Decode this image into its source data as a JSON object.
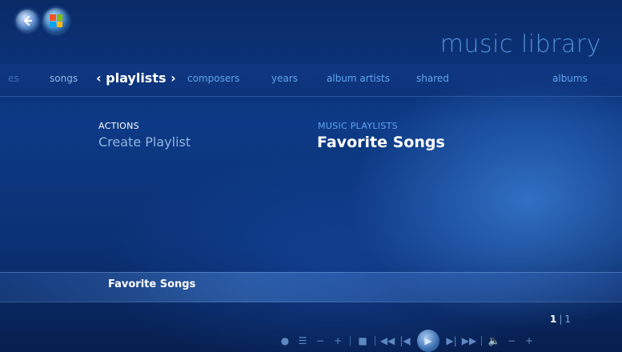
{
  "app": {
    "title": "music library",
    "icons": {
      "back": "back-arrow-icon",
      "start": "windows-start-icon"
    }
  },
  "pivot": {
    "items": [
      {
        "label": "es"
      },
      {
        "label": "songs"
      },
      {
        "label": "‹ playlists ›",
        "selected": true
      },
      {
        "label": "composers"
      },
      {
        "label": "years"
      },
      {
        "label": "album artists"
      },
      {
        "label": "shared"
      },
      {
        "label": "albums"
      }
    ]
  },
  "actions": {
    "heading": "ACTIONS",
    "create_playlist": "Create Playlist"
  },
  "playlists": {
    "heading": "MUSIC PLAYLISTS",
    "items": [
      "Favorite Songs"
    ]
  },
  "focus": {
    "label": "Favorite Songs"
  },
  "pager": {
    "current": "1",
    "separator": "|",
    "total": "1"
  },
  "transport": {
    "buttons": [
      "record",
      "guide",
      "channel-down",
      "channel-up",
      "stop",
      "rewind",
      "skip-back",
      "play",
      "skip-forward",
      "fast-forward",
      "mute",
      "volume-down",
      "volume-up"
    ]
  },
  "colors": {
    "accent": "#5fa4f2",
    "title": "#4f8fd8",
    "background": "#0d3a86"
  }
}
